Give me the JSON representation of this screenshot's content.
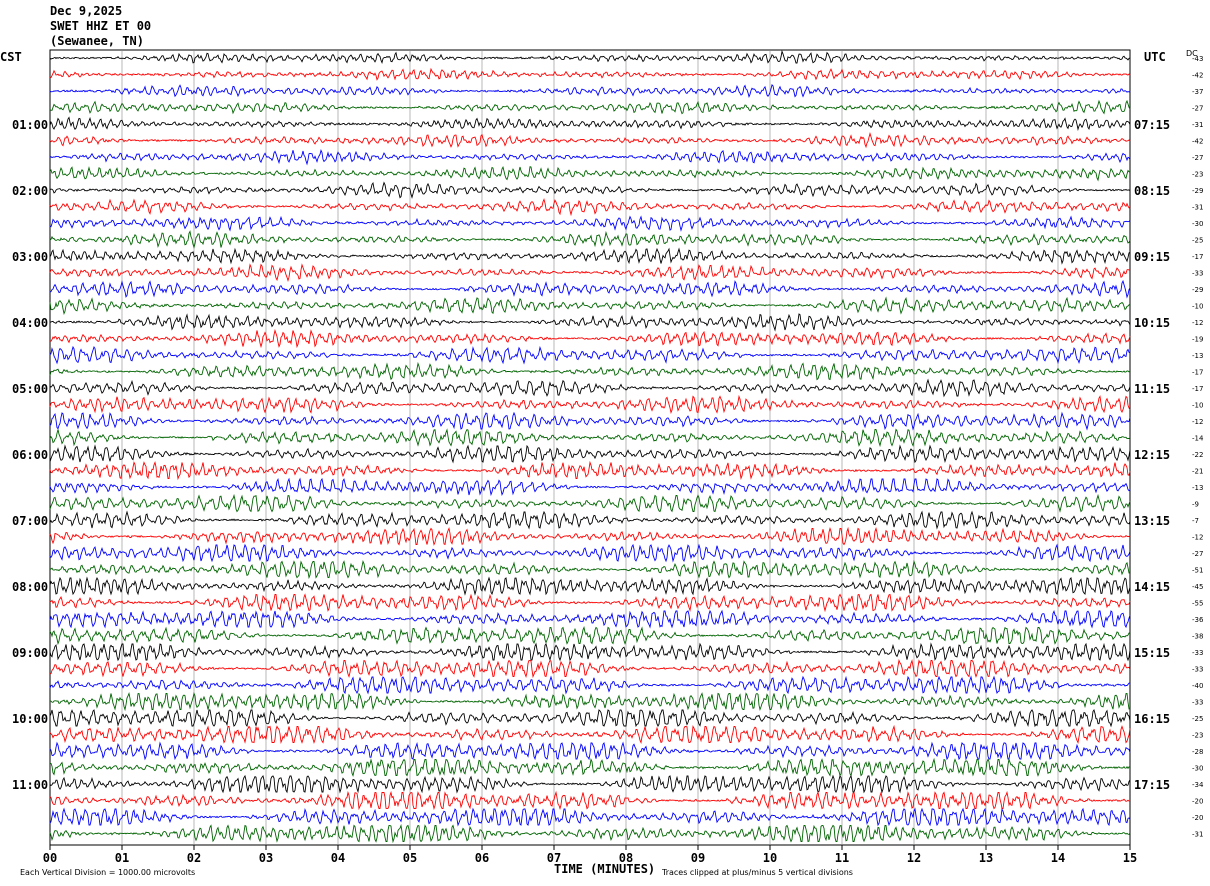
{
  "header": {
    "date": "Dec 9,2025",
    "station": "SWET HHZ ET 00",
    "location": "(Sewanee, TN)"
  },
  "left_axis_title": "CST",
  "right_axis_title": "UTC",
  "dc_title": "DC",
  "footer": {
    "scale_note": "Each Vertical Division = 1000.00 microvolts",
    "xaxis_title": "TIME (MINUTES)",
    "clip_note": "Traces clipped at plus/minus 5 vertical divisions"
  },
  "colors": {
    "trace_cycle": [
      "#000000",
      "#ff0000",
      "#0000ff",
      "#006400"
    ],
    "grid": "#888888"
  },
  "chart_data": {
    "type": "line",
    "description": "helicorder seismogram, 48 traces of 15 minutes each",
    "xlabel": "TIME (MINUTES)",
    "xlim": [
      0,
      15
    ],
    "x_ticks": [
      "00",
      "01",
      "02",
      "03",
      "04",
      "05",
      "06",
      "07",
      "08",
      "09",
      "10",
      "11",
      "12",
      "13",
      "14",
      "15"
    ],
    "minutes_per_trace": 15,
    "left_hour_labels": [
      "01:00",
      "02:00",
      "03:00",
      "04:00",
      "05:00",
      "06:00",
      "07:00",
      "08:00",
      "09:00",
      "10:00",
      "11:00"
    ],
    "right_hour_labels": [
      "07:15",
      "08:15",
      "09:15",
      "10:15",
      "11:15",
      "12:15",
      "13:15",
      "14:15",
      "15:15",
      "16:15",
      "17:15"
    ],
    "dc_offsets": [
      -43,
      -42,
      -37,
      -27,
      -31,
      -42,
      -27,
      -23,
      -29,
      -31,
      -30,
      -25,
      -17,
      -33,
      -29,
      -10,
      -12,
      -19,
      -13,
      -17,
      -17,
      -10,
      -12,
      -14,
      -22,
      -21,
      -13,
      -9,
      -7,
      -12,
      -27,
      -51,
      -45,
      -55,
      -36,
      -38,
      -33,
      -33,
      -40,
      -33,
      -25,
      -23,
      -28,
      -30,
      -34,
      -20,
      -20,
      -31
    ],
    "trace_count": 48
  }
}
